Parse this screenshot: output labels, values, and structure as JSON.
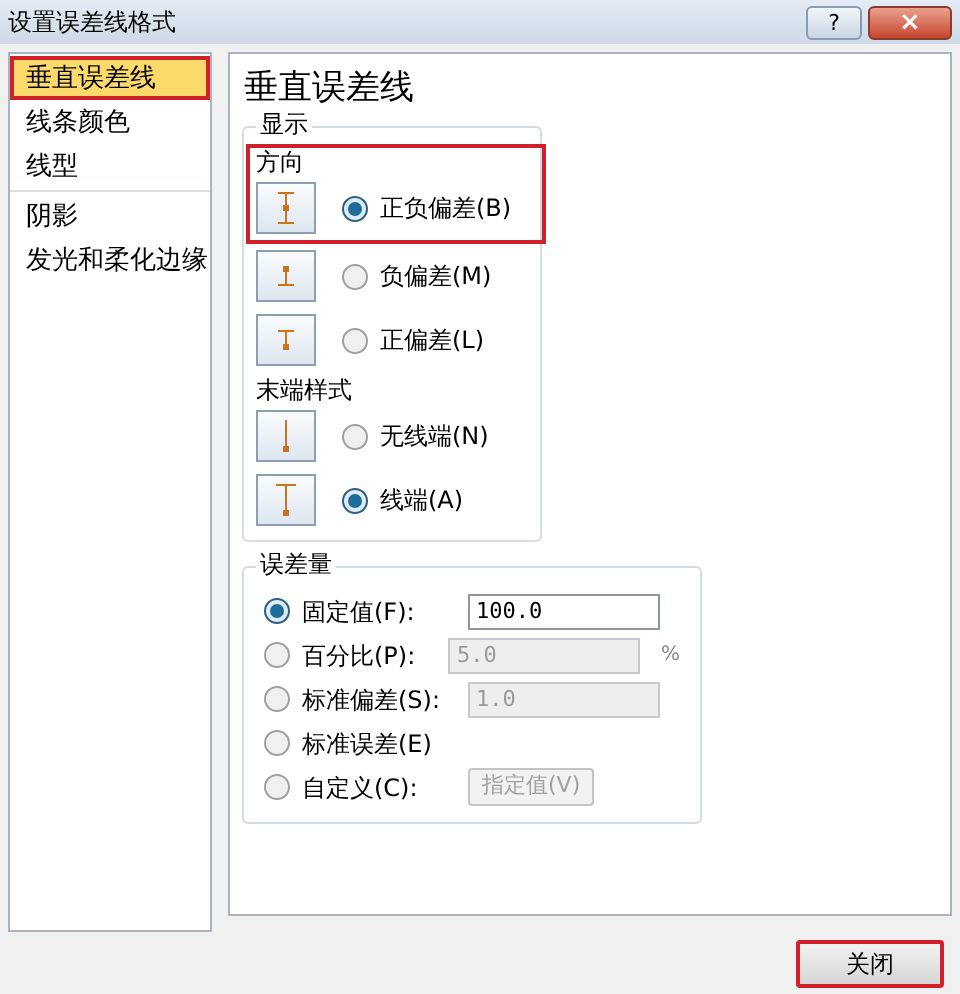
{
  "window": {
    "title": "设置误差线格式",
    "help": "?",
    "close": "×"
  },
  "sidebar": {
    "groups": [
      [
        {
          "label": "垂直误差线",
          "selected": true,
          "highlighted": true
        },
        {
          "label": "线条颜色",
          "selected": false,
          "highlighted": false
        },
        {
          "label": "线型",
          "selected": false,
          "highlighted": false
        }
      ],
      [
        {
          "label": "阴影",
          "selected": false,
          "highlighted": false
        },
        {
          "label": "发光和柔化边缘",
          "selected": false,
          "highlighted": false
        }
      ]
    ]
  },
  "panel": {
    "heading": "垂直误差线",
    "display": {
      "legend": "显示",
      "direction": {
        "label": "方向",
        "highlighted": true,
        "options": [
          {
            "kind": "both",
            "label": "正负偏差(B)",
            "selected": true
          },
          {
            "kind": "minus",
            "label": "负偏差(M)",
            "selected": false
          },
          {
            "kind": "plus",
            "label": "正偏差(L)",
            "selected": false
          }
        ]
      },
      "end_style": {
        "label": "末端样式",
        "options": [
          {
            "kind": "no_cap",
            "label": "无线端(N)",
            "selected": false
          },
          {
            "kind": "cap",
            "label": "线端(A)",
            "selected": true
          }
        ]
      }
    },
    "amount": {
      "legend": "误差量",
      "options": [
        {
          "kind": "field",
          "label": "固定值(F):",
          "selected": true,
          "value": "100.0",
          "disabled": false
        },
        {
          "kind": "field",
          "label": "百分比(P):",
          "selected": false,
          "value": "5.0",
          "disabled": true,
          "unit": "%"
        },
        {
          "kind": "field",
          "label": "标准偏差(S):",
          "selected": false,
          "value": "1.0",
          "disabled": true
        },
        {
          "kind": "plain",
          "label": "标准误差(E)",
          "selected": false
        },
        {
          "kind": "button",
          "label": "自定义(C):",
          "selected": false,
          "button": "指定值(V)",
          "disabled": true
        }
      ]
    }
  },
  "footer": {
    "close_button": {
      "label": "关闭",
      "highlighted": true
    }
  }
}
